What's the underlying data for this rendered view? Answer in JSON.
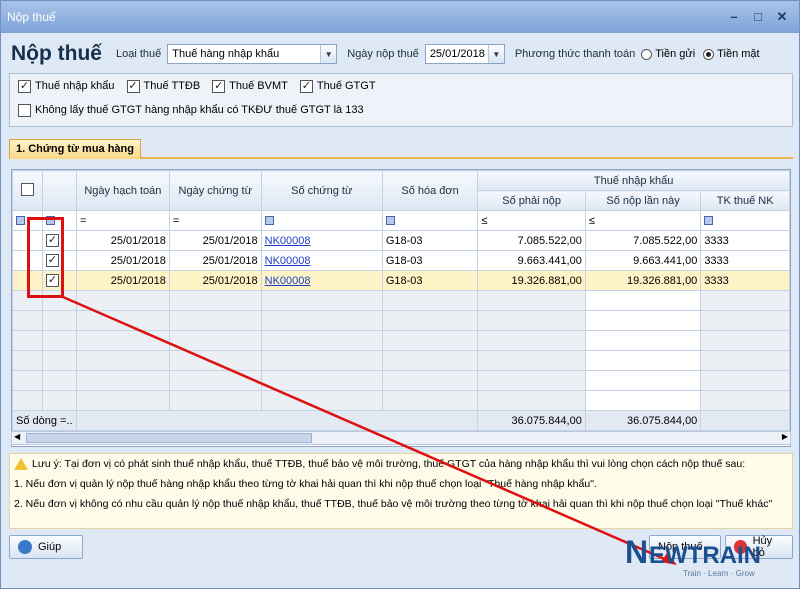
{
  "window": {
    "title": "Nộp thuế"
  },
  "header": {
    "title": "Nộp thuế",
    "tax_type_label": "Loại thuế",
    "tax_type_value": "Thuế hàng nhập khẩu",
    "date_label": "Ngày nộp thuế",
    "date_value": "25/01/2018",
    "payment_label": "Phương thức thanh toán",
    "payment_opt1": "Tiền gửi",
    "payment_opt2": "Tiền mặt"
  },
  "checks": [
    {
      "label": "Thuế nhập khẩu",
      "checked": true
    },
    {
      "label": "Thuế TTĐB",
      "checked": true
    },
    {
      "label": "Thuế BVMT",
      "checked": true
    },
    {
      "label": "Thuế GTGT",
      "checked": true
    }
  ],
  "extra_check": {
    "label": "Không lấy thuế GTGT hàng nhập khẩu có TKĐƯ thuế GTGT là 133",
    "checked": false
  },
  "tab": {
    "label": "1. Chứng từ mua hàng"
  },
  "grid": {
    "group_header": "Thuế nhập khẩu",
    "columns": [
      "Ngày hạch toán",
      "Ngày chứng từ",
      "Số chứng từ",
      "Số hóa đơn",
      "Số phải nộp",
      "Số nộp lần này",
      "TK thuế NK"
    ],
    "rows": [
      {
        "ngay_ht": "25/01/2018",
        "ngay_ct": "25/01/2018",
        "so_ct": "NK00008",
        "so_hd": "G18-03",
        "phai_nop": "7.085.522,00",
        "nop_lan_nay": "7.085.522,00",
        "tk": "3333"
      },
      {
        "ngay_ht": "25/01/2018",
        "ngay_ct": "25/01/2018",
        "so_ct": "NK00008",
        "so_hd": "G18-03",
        "phai_nop": "9.663.441,00",
        "nop_lan_nay": "9.663.441,00",
        "tk": "3333"
      },
      {
        "ngay_ht": "25/01/2018",
        "ngay_ct": "25/01/2018",
        "so_ct": "NK00008",
        "so_hd": "G18-03",
        "phai_nop": "19.326.881,00",
        "nop_lan_nay": "19.326.881,00",
        "tk": "3333"
      }
    ],
    "sum_label": "Số dòng =..",
    "sum_phai_nop": "36.075.844,00",
    "sum_nop_lan_nay": "36.075.844,00"
  },
  "note": {
    "line1": "Lưu ý: Tại đơn vị có phát sinh thuế nhập khẩu, thuế TTĐB, thuế bảo vệ môi trường, thuế GTGT của hàng nhập khẩu thì vui lòng chọn cách nộp thuế sau:",
    "line2": "1. Nếu đơn vị quản lý nộp thuế hàng nhập khẩu theo từng tờ khai hải quan thì khi nộp thuế chọn loại \"Thuế hàng nhập khẩu\".",
    "line3": "2. Nếu đơn vị không có nhu cầu quản lý nộp thuế nhập khẩu, thuế TTĐB, thuế bảo vệ môi trường theo từng tờ khai hải quan thì khi nộp thuế chọn loại \"Thuế khác\""
  },
  "buttons": {
    "help": "Giúp",
    "pay": "Nộp thuế",
    "cancel": "Hủy bỏ"
  },
  "watermark": {
    "text": "NEWTRAIN",
    "tagline": "Train · Learn · Grow"
  }
}
